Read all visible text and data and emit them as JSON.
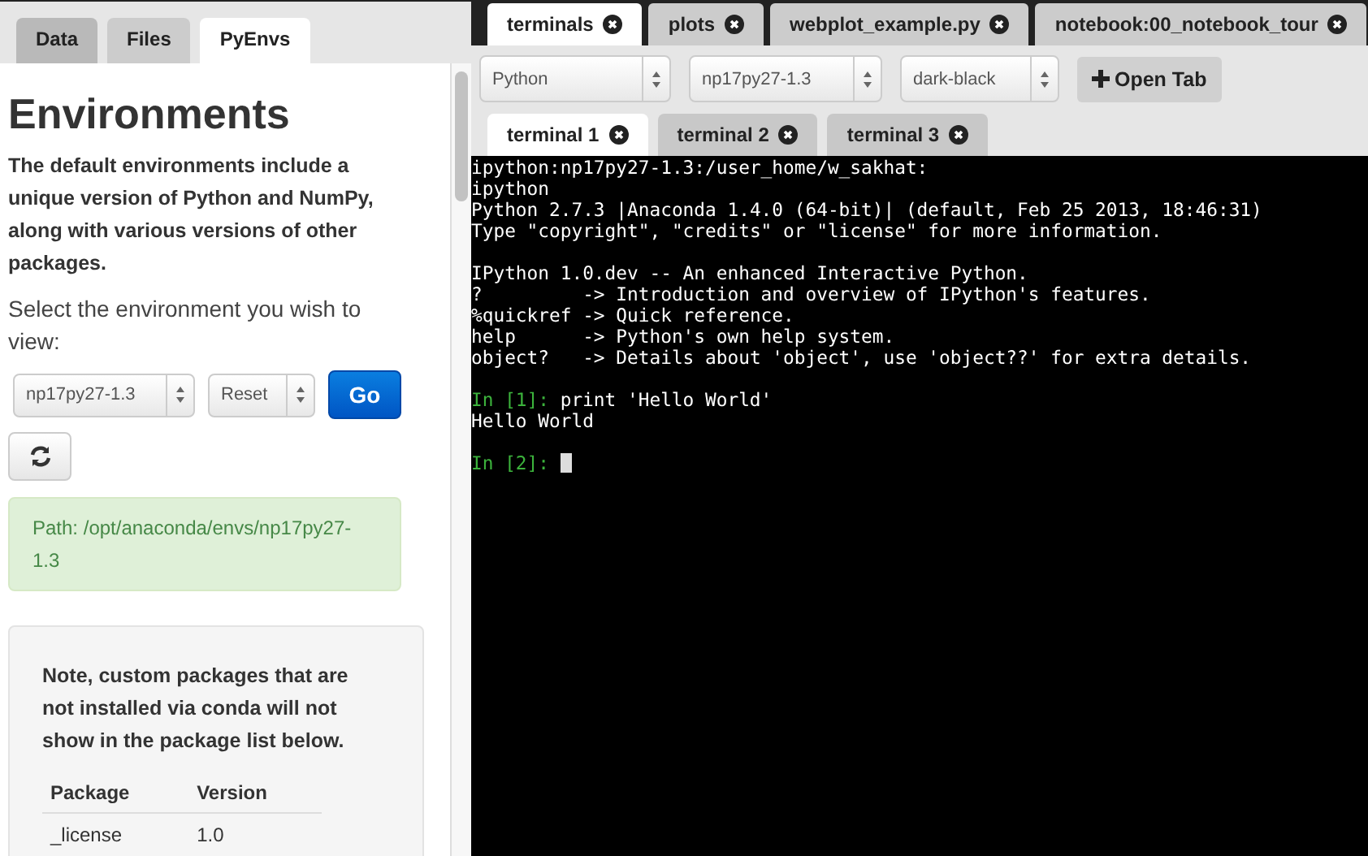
{
  "left_tabs": [
    {
      "label": "Data",
      "selected": false
    },
    {
      "label": "Files",
      "selected": false
    },
    {
      "label": "PyEnvs",
      "selected": true
    }
  ],
  "heading": "Environments",
  "intro": "The default environments include a unique version of Python and NumPy, along with various versions of other packages.",
  "select_label": "Select the environment you wish to view:",
  "env_select": "np17py27-1.3",
  "action_select": "Reset",
  "go_button": "Go",
  "path": "Path: /opt/anaconda/envs/np17py27-1.3",
  "note": "Note, custom packages that are not installed via conda will not show in the package list below.",
  "packages": {
    "columns": [
      "Package",
      "Version"
    ],
    "rows": [
      [
        "_license",
        "1.0"
      ]
    ]
  },
  "main_tabs": [
    {
      "label": "terminals",
      "selected": true
    },
    {
      "label": "plots",
      "selected": false
    },
    {
      "label": "webplot_example.py",
      "selected": false
    },
    {
      "label": "notebook:00_notebook_tour",
      "selected": false
    }
  ],
  "toolbar": {
    "selects": [
      "Python",
      "np17py27-1.3",
      "dark-black"
    ],
    "open_button": "Open Tab"
  },
  "terminal_tabs": [
    {
      "label": "terminal 1",
      "selected": true
    },
    {
      "label": "terminal 2",
      "selected": false
    },
    {
      "label": "terminal 3",
      "selected": false
    }
  ],
  "terminal_blocks": [
    [
      {
        "text": "ipython:np17py27-1.3:/user_home/w_sakhat:"
      },
      {
        "text": "ipython"
      },
      {
        "text": "Python 2.7.3 |Anaconda 1.4.0 (64-bit)| (default, Feb 25 2013, 18:46:31)"
      },
      {
        "text": "Type \"copyright\", \"credits\" or \"license\" for more information."
      }
    ],
    [
      {
        "text": "IPython 1.0.dev -- An enhanced Interactive Python."
      },
      {
        "text": "?         -> Introduction and overview of IPython's features."
      },
      {
        "text": "%quickref -> Quick reference."
      },
      {
        "text": "help      -> Python's own help system."
      },
      {
        "text": "object?   -> Details about 'object', use 'object??' for extra details."
      }
    ],
    [
      {
        "prompt": "In [1]:",
        "text": "print 'Hello World'"
      },
      {
        "text": "Hello World"
      }
    ],
    [
      {
        "prompt": "In [2]:",
        "cursor": true
      }
    ]
  ]
}
